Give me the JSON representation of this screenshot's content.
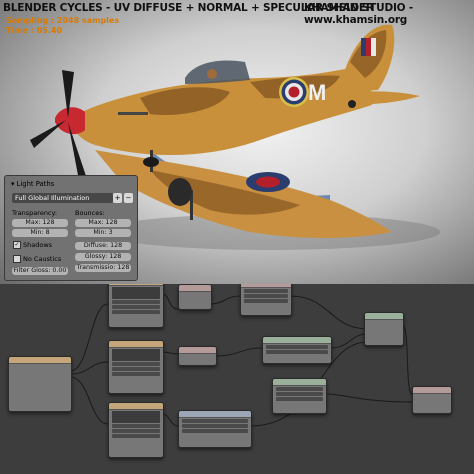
{
  "header": {
    "title": "BLENDER CYCLES - UV DIFFUSE + NORMAL + SPECULAR SHADER",
    "studio": "KHAMSIN STUDIO - www.khamsin.org"
  },
  "stats": {
    "sampling": "Sampling : 2048 samples",
    "time": "Time : 05.40"
  },
  "aircraft": {
    "code_letter": "M"
  },
  "light_paths": {
    "title": "Light Paths",
    "preset": "Full Global Illumination",
    "transparency_label": "Transparency:",
    "bounces_label": "Bounces:",
    "trans_max": "Max: 128",
    "trans_min": "Min: 8",
    "bounce_max": "Max: 128",
    "bounce_min": "Min: 3",
    "shadows_label": "Shadows",
    "shadows_checked": true,
    "no_caustics_label": "No Caustics",
    "no_caustics_checked": false,
    "diffuse": "Diffuse: 128",
    "glossy": "Glossy: 128",
    "transmission": "Transmissio: 128",
    "filter_gloss": "Filter Gloss: 0.00"
  },
  "colors": {
    "accent_orange": "#d97a00",
    "camo_sand": "#c9903c",
    "camo_brown": "#8a5a22",
    "roundel_red": "#b3202a",
    "roundel_blue": "#2b3c6e",
    "underside_blue": "#6d86b0"
  }
}
